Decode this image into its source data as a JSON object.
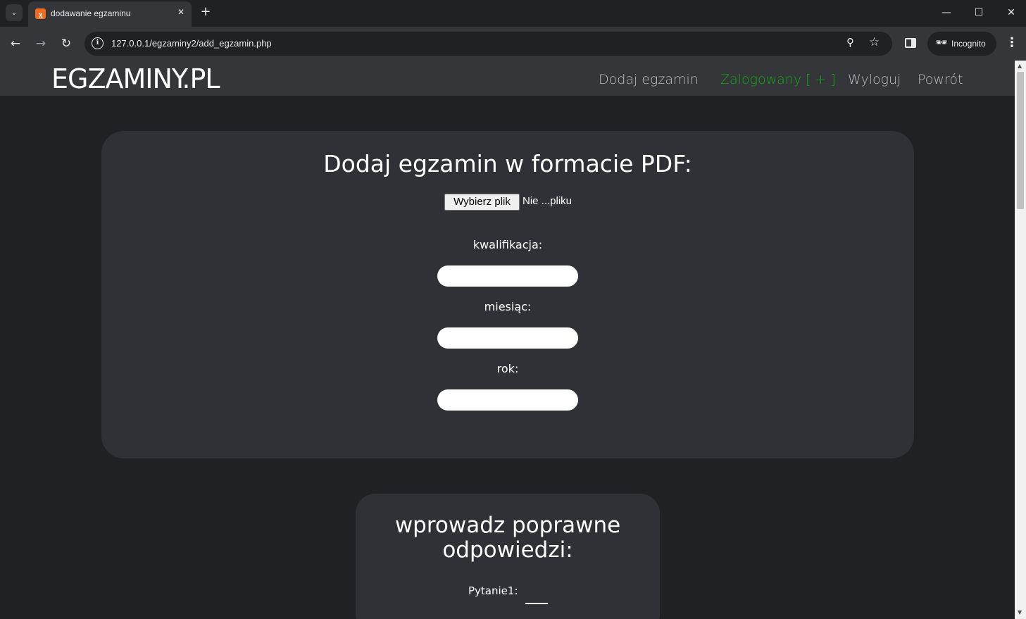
{
  "browser": {
    "tab_title": "dodawanie egzaminu",
    "tab_favicon": "xampp",
    "url": "127.0.0.1/egzaminy2/add_egzamin.php",
    "incognito_label": "Incognito"
  },
  "header": {
    "logo": "EGZAMINY.PL",
    "nav": {
      "add_exam": "Dodaj egzamin",
      "logged_in": "Zalogowany [ + ]",
      "logout": "Wyloguj",
      "back": "Powrót"
    },
    "logged_in_color": "#10a814"
  },
  "upload_form": {
    "title": "Dodaj egzamin w formacie PDF:",
    "file_button": "Wybierz plik",
    "file_status": "Nie ...pliku",
    "qualification_label": "kwalifikacja:",
    "qualification_value": "",
    "month_label": "miesiąc:",
    "month_value": "",
    "year_label": "rok:",
    "year_value": ""
  },
  "answers_form": {
    "title": "wprowadz poprawne odpowiedzi:",
    "question_label": "Pytanie1:",
    "question_value": ""
  },
  "colors": {
    "page_bg": "#202124",
    "card_bg": "#303136",
    "header_bg": "#35363a"
  }
}
